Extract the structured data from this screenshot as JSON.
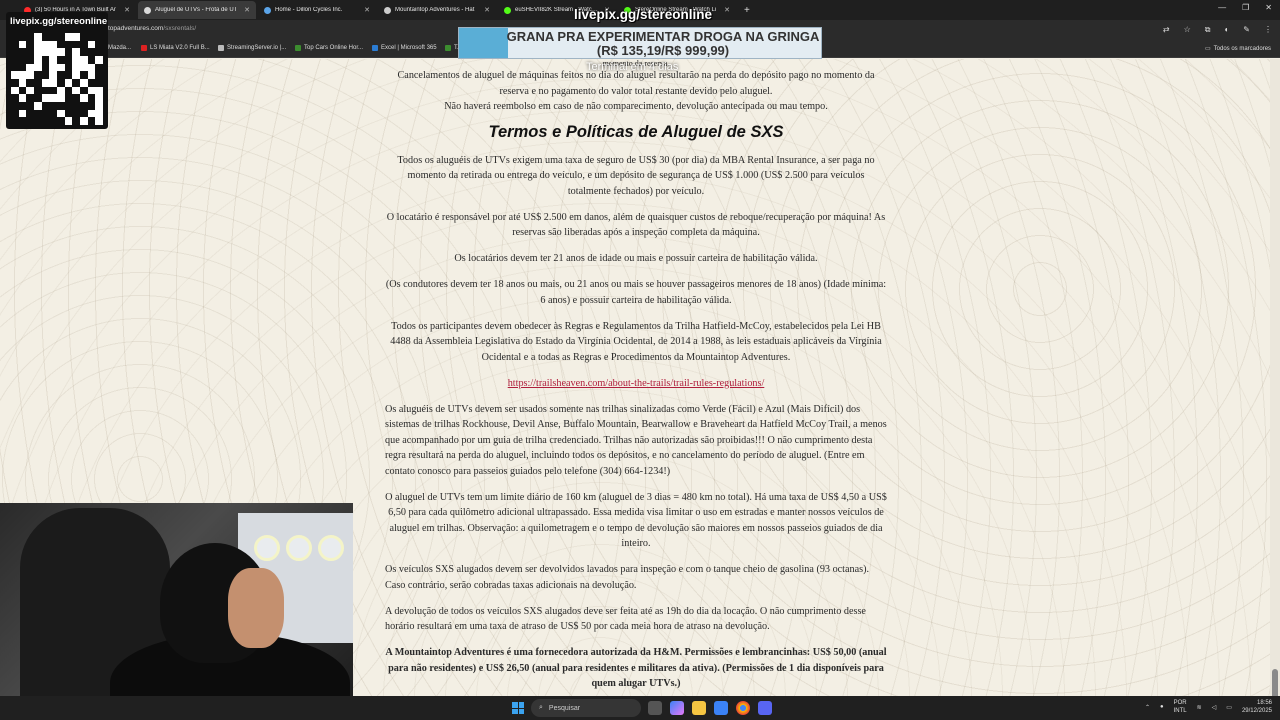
{
  "browser": {
    "tabs": [
      {
        "label": "(3) 50 Hours in A Town Built Ar",
        "color": "#ff2a2a",
        "active": false
      },
      {
        "label": "Aluguel de UTVs - Frota de UT",
        "color": "#d9d9d9",
        "active": true
      },
      {
        "label": "Home - Dillon Cycles Inc.",
        "color": "#5ba4e8",
        "active": false
      },
      {
        "label": "Mountaintop Adventures - Hat",
        "color": "#cccccc",
        "active": false
      },
      {
        "label": "euSHEVII82K Stream - Watch Li",
        "color": "#53fc18",
        "active": false
      },
      {
        "label": "StereOnline Stream - Watch Li",
        "color": "#53fc18",
        "active": false
      }
    ],
    "url_host": "topadventures.com",
    "url_path": "/sxsrentals/",
    "bookmarks": [
      {
        "label": "Mazda...",
        "color": "#888888"
      },
      {
        "label": "LS Miata V2.0 Full B...",
        "color": "#d22"
      },
      {
        "label": "StreamingServer.io |...",
        "color": "#bbbbbb"
      },
      {
        "label": "Top Cars Online Hor...",
        "color": "#3c8d2f"
      },
      {
        "label": "Excel | Microsoft 365",
        "color": "#2b7cd3"
      },
      {
        "label": "T...",
        "color": "#3c8d2f"
      }
    ],
    "all_bookmarks_label": "Todos os marcadores"
  },
  "article": {
    "cut_line": "momento da reserva.",
    "intro_para_1": "Cancelamentos de aluguel de máquinas feitos no dia do aluguel resultarão na perda do depósito pago no momento da reserva e no pagamento do valor total restante devido pelo aluguel.",
    "intro_para_2": "Não haverá reembolso em caso de não comparecimento, devolução antecipada ou mau tempo.",
    "heading": "Termos e Políticas de Aluguel de SXS",
    "p1": "Todos os aluguéis de UTVs exigem uma taxa de seguro de US$ 30 (por dia) da MBA Rental Insurance, a ser paga no momento da retirada ou entrega do veículo, e um depósito de segurança de US$ 1.000 (US$ 2.500 para veículos totalmente fechados) por veículo.",
    "p2": "O locatário é responsável por até US$ 2.500 em danos, além de quaisquer custos de reboque/recuperação por máquina! As reservas são liberadas após a inspeção completa da máquina.",
    "p3": "Os locatários devem ter 21 anos de idade ou mais e possuir carteira de habilitação válida.",
    "p4": "(Os condutores devem ter 18 anos ou mais, ou 21 anos ou mais se houver passageiros menores de 18 anos) (Idade mínima: 6 anos) e possuir carteira de habilitação válida.",
    "p5": "Todos os participantes devem obedecer às Regras e Regulamentos da Trilha Hatfield-McCoy, estabelecidos pela Lei HB 4488 da Assembleia Legislativa do Estado da Virgínia Ocidental, de 2014 a 1988, às leis estaduais aplicáveis da Virgínia Ocidental e a todas as Regras e Procedimentos da Mountaintop Adventures.",
    "link": "https://trailsheaven.com/about-the-trails/trail-rules-regulations/",
    "p6": "Os aluguéis de UTVs devem ser usados somente nas trilhas sinalizadas como Verde (Fácil) e Azul (Mais Difícil) dos sistemas de trilhas Rockhouse, Devil Anse, Buffalo Mountain, Bearwallow e Braveheart da Hatfield McCoy Trail, a menos que acompanhado por um guia de trilha credenciado. Trilhas não autorizadas são proibidas!!! O não cumprimento desta regra resultará na perda do aluguel, incluindo todos os depósitos, e no cancelamento do período de aluguel. (Entre em contato conosco para passeios guiados pelo telefone (304) 664-1234!)",
    "p7": "O aluguel de UTVs tem um limite diário de 160 km (aluguel de 3 dias = 480 km no total). Há uma taxa de US$ 4,50 a US$ 6,50 para cada quilômetro adicional ultrapassado. Essa medida visa limitar o uso em estradas e manter nossos veículos de aluguel em trilhas. Observação: a quilometragem e o tempo de devolução são maiores em nossos passeios guiados de dia inteiro.",
    "p8": "Os veículos SXS alugados devem ser devolvidos lavados para inspeção e com o tanque cheio de gasolina (93 octanas). Caso contrário, serão cobradas taxas adicionais na devolução.",
    "p9": "A devolução de todos os veículos SXS alugados deve ser feita até as 19h do dia da locação. O não cumprimento desse horário resultará em uma taxa de atraso de US$ 50 por cada meia hora de atraso na devolução.",
    "p10": "A Mountaintop Adventures é uma fornecedora autorizada da H&M. Permissões e lembrancinhas: US$ 50,00 (anual para não residentes) e US$ 26,50 (anual para residentes e militares da ativa). (Permissões de 1 dia disponíveis para quem alugar UTVs.)"
  },
  "overlay": {
    "qr_label": "livepix.gg/stereonline",
    "livepix_title": "livepix.gg/stereonline",
    "donate_line1": "GRANA PRA EXPERIMENTAR DROGA NA GRINGA",
    "donate_line2": "(R$ 135,19/R$ 999,99)",
    "donate_sub": "Terminal em 4 dias"
  },
  "taskbar": {
    "search_placeholder": "Pesquisar",
    "lang_top": "POR",
    "lang_bottom": "INTL",
    "time": "18:56",
    "date": "29/12/2025"
  }
}
